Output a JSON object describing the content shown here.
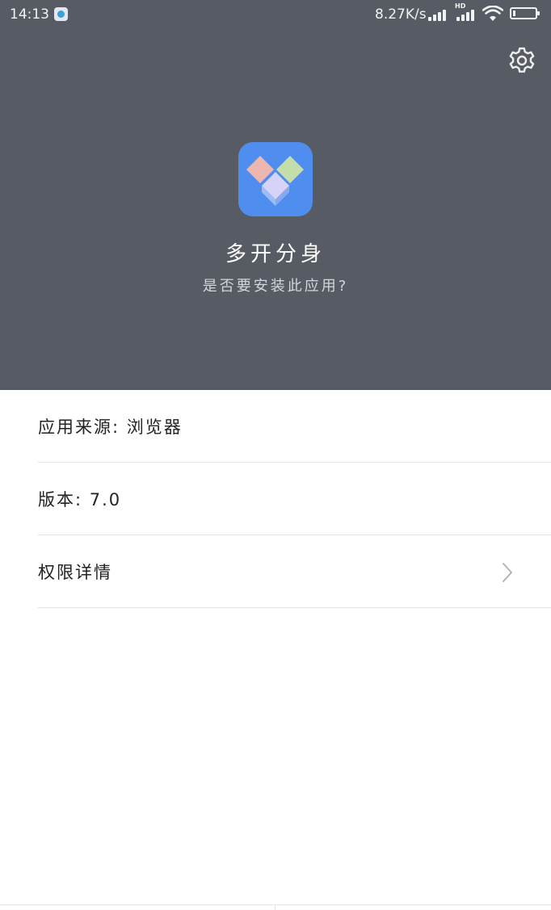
{
  "status_bar": {
    "time": "14:13",
    "network_speed": "8.27K/s",
    "hd_label": "HD",
    "icons": [
      "notification-app-icon",
      "signal-icon",
      "signal-hd-icon",
      "wifi-icon",
      "battery-icon"
    ]
  },
  "header": {
    "background_color": "#575b64",
    "settings_icon": "gear-icon",
    "app_icon": "app-logo-icon",
    "app_icon_color": "#4f8eee",
    "app_name": "多开分身",
    "question": "是否要安装此应用?"
  },
  "details": {
    "source": "应用来源: 浏览器",
    "version": "版本: 7.0",
    "permissions_label": "权限详情",
    "permissions_icon": "chevron-right-icon"
  }
}
